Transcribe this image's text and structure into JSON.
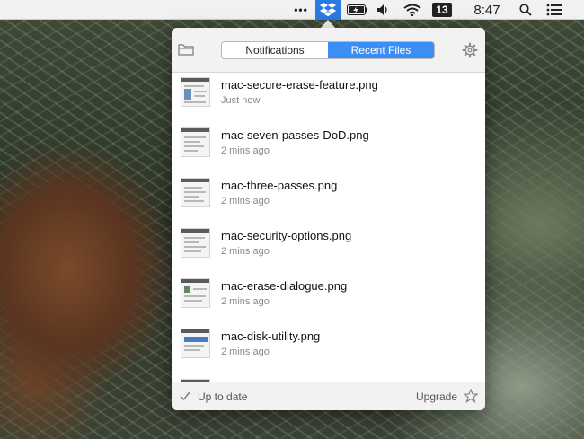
{
  "menubar": {
    "overflow_label": "•••",
    "icons": [
      "dropbox-icon",
      "battery-charging-icon",
      "volume-icon",
      "wifi-icon",
      "search-icon",
      "notification-list-icon"
    ],
    "badge": "13",
    "clock": "8:47"
  },
  "dropbox": {
    "tabs": [
      {
        "label": "Notifications",
        "active": false
      },
      {
        "label": "Recent Files",
        "active": true
      }
    ],
    "files": [
      {
        "name": "mac-secure-erase-feature.png",
        "time": "Just now"
      },
      {
        "name": "mac-seven-passes-DoD.png",
        "time": "2 mins ago"
      },
      {
        "name": "mac-three-passes.png",
        "time": "2 mins ago"
      },
      {
        "name": "mac-security-options.png",
        "time": "2 mins ago"
      },
      {
        "name": "mac-erase-dialogue.png",
        "time": "2 mins ago"
      },
      {
        "name": "mac-disk-utility.png",
        "time": "2 mins ago"
      }
    ],
    "footer": {
      "status": "Up to date",
      "upgrade_label": "Upgrade"
    }
  },
  "colors": {
    "accent": "#3b8ef5",
    "menubar_highlight": "#2a7ae2"
  }
}
